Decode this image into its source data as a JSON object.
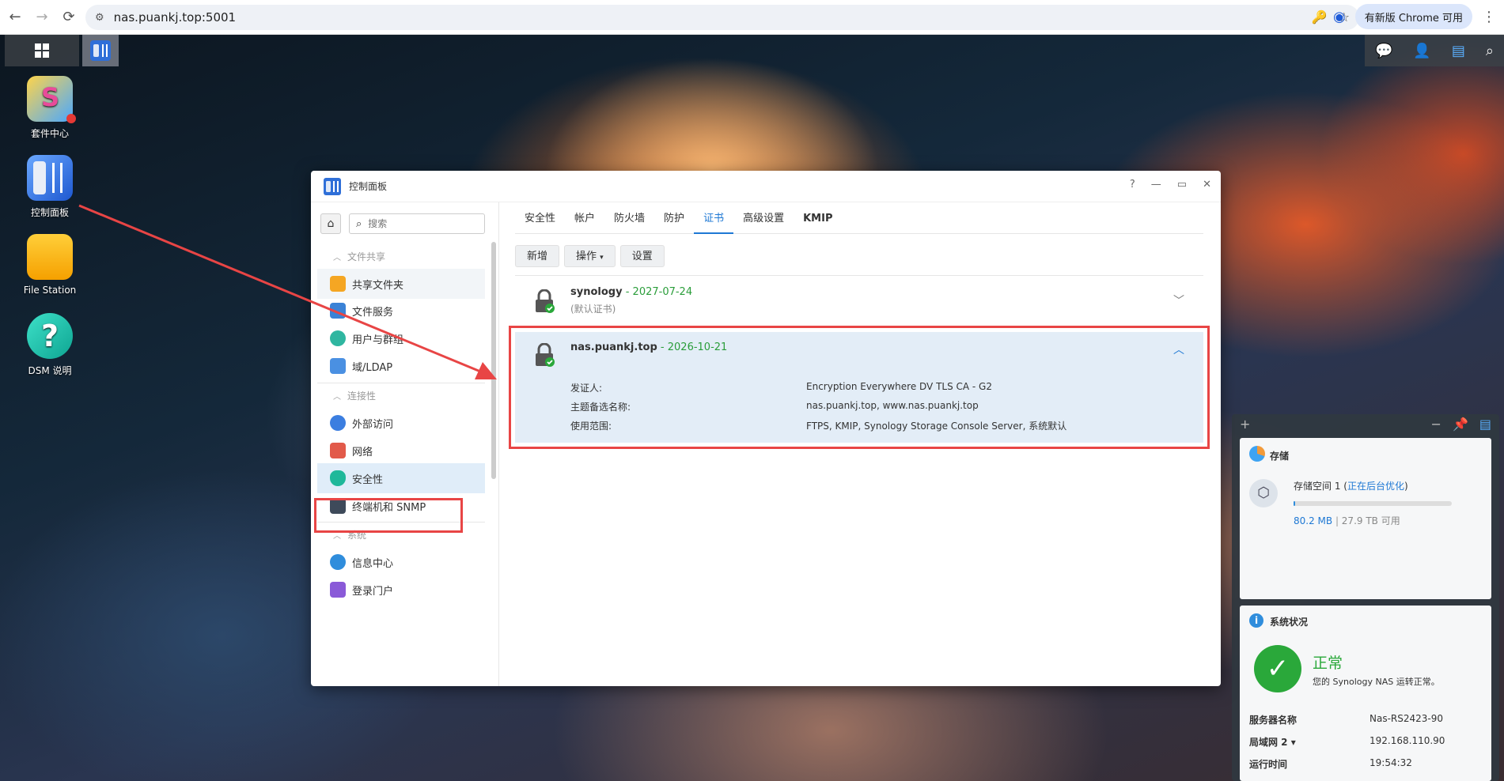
{
  "browser": {
    "url": "nas.puankj.top:5001",
    "update_label": "有新版 Chrome 可用"
  },
  "desktop": {
    "icons": [
      {
        "label": "套件中心"
      },
      {
        "label": "控制面板"
      },
      {
        "label": "File Station"
      },
      {
        "label": "DSM 说明"
      }
    ]
  },
  "window": {
    "title": "控制面板",
    "search_placeholder": "搜索",
    "sidebar": {
      "sections": [
        {
          "label": "文件共享"
        },
        {
          "label": "连接性"
        },
        {
          "label": "系统"
        }
      ],
      "items": [
        {
          "label": "共享文件夹"
        },
        {
          "label": "文件服务"
        },
        {
          "label": "用户与群组"
        },
        {
          "label": "域/LDAP"
        },
        {
          "label": "外部访问"
        },
        {
          "label": "网络"
        },
        {
          "label": "安全性"
        },
        {
          "label": "终端机和 SNMP"
        },
        {
          "label": "信息中心"
        },
        {
          "label": "登录门户"
        }
      ]
    },
    "tabs": [
      {
        "label": "安全性"
      },
      {
        "label": "帐户"
      },
      {
        "label": "防火墙"
      },
      {
        "label": "防护"
      },
      {
        "label": "证书"
      },
      {
        "label": "高级设置"
      },
      {
        "label": "KMIP"
      }
    ],
    "toolbar": {
      "add": "新增",
      "action": "操作",
      "settings": "设置"
    },
    "certs": [
      {
        "name": "synology",
        "sep": " - ",
        "date": "2027-07-24",
        "sub": "(默认证书)"
      },
      {
        "name": "nas.puankj.top",
        "sep": " - ",
        "date": "2026-10-21",
        "details": [
          {
            "label": "发证人:",
            "value": "Encryption Everywhere DV TLS CA - G2"
          },
          {
            "label": "主题备选名称:",
            "value": "nas.puankj.top, www.nas.puankj.top"
          },
          {
            "label": "使用范围:",
            "value": "FTPS, KMIP, Synology Storage Console Server, 系统默认"
          }
        ]
      }
    ]
  },
  "widget": {
    "storage": {
      "title": "存储",
      "volume": "存储空间 1 (",
      "volume_status": "正在后台优化",
      "volume_end": ")",
      "used": "80.2 MB",
      "sep": " | ",
      "free": "27.9 TB 可用",
      "used_fraction": 0.01
    },
    "status": {
      "title": "系统状况",
      "state": "正常",
      "desc": "您的 Synology NAS 运转正常。",
      "rows": [
        {
          "key": "服务器名称",
          "value": "Nas-RS2423-90"
        },
        {
          "key": "局域网 2 ▾",
          "value": "192.168.110.90"
        },
        {
          "key": "运行时间",
          "value": "19:54:32"
        }
      ]
    }
  },
  "colors": {
    "accent": "#1e78d4",
    "date_green": "#2a9d3a",
    "highlight_red": "#e84545",
    "status_green": "#2aa83a"
  }
}
